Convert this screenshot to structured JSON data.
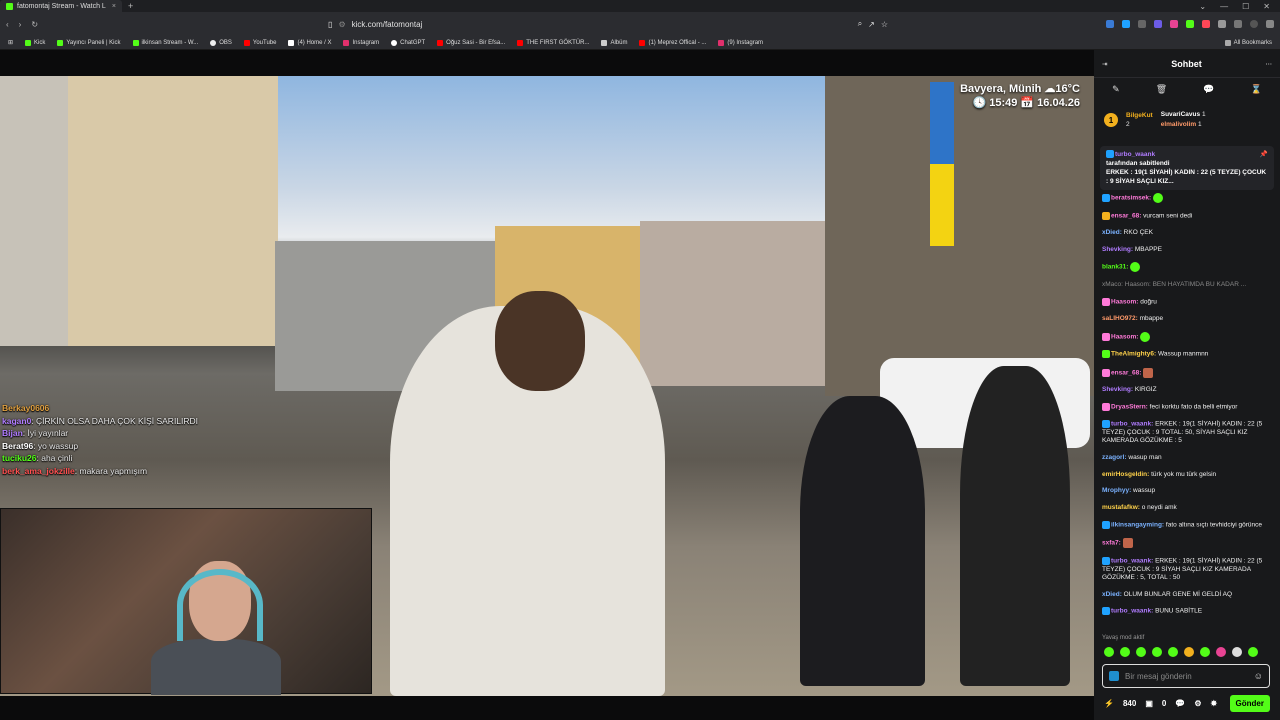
{
  "tab": {
    "title": "fatomontaj Stream - Watch L",
    "close": "×",
    "new": "+"
  },
  "window": {
    "min": "—",
    "max": "☐",
    "close": "✕"
  },
  "url": {
    "address": "kick.com/fatomontaj"
  },
  "bookmarks": [
    {
      "label": "Kick",
      "color": "#53fc18"
    },
    {
      "label": "Yayıncı Paneli | Kick",
      "color": "#53fc18"
    },
    {
      "label": "ilkinsan Stream - W...",
      "color": "#53fc18"
    },
    {
      "label": "OBS",
      "color": "#eeeeee"
    },
    {
      "label": "YouTube",
      "color": "#ff0000"
    },
    {
      "label": "(4) Home / X",
      "color": "#ffffff"
    },
    {
      "label": "Instagram",
      "color": "#e1306c"
    },
    {
      "label": "ChatGPT",
      "color": "#ffffff"
    },
    {
      "label": "Oğuz Sasi - Bir Efsa...",
      "color": "#ff0000"
    },
    {
      "label": "THE FIRST GÖKTÜR...",
      "color": "#ff0000"
    },
    {
      "label": "Albüm",
      "color": "#cccccc"
    },
    {
      "label": "(1) Meprez Offical - ...",
      "color": "#ff0000"
    },
    {
      "label": "(9) Instagram",
      "color": "#e1306c"
    }
  ],
  "all_bookmarks": "All Bookmarks",
  "overlay": {
    "location": "Bavyera, Münih ☁16°C",
    "time": "🕓 15:49  📅 16.04.26"
  },
  "video_chat": [
    {
      "user": "Berkay0606",
      "text": " ",
      "color": "#e0a040"
    },
    {
      "user": "kagan0",
      "text": ": ÇİRKİN OLSA DAHA ÇOK KİŞİ SARILIRDI",
      "color": "#b07cff"
    },
    {
      "user": "Bijan",
      "text": ": İyi yayınlar",
      "color": "#b07cff"
    },
    {
      "user": "Berat96",
      "text": ": yo wassup",
      "color": "#ffffff"
    },
    {
      "user": "tuciku26",
      "text": ": aha çinli",
      "color": "#53fc18"
    },
    {
      "user": "berk_ama_jokzille",
      "text": ": makara yapmışım",
      "color": "#ff5050"
    }
  ],
  "chat": {
    "title": "Sohbet",
    "leaderboard": [
      {
        "rank": "1",
        "name": "BilgeKut",
        "count": "2"
      },
      {
        "name": "SuvariCavus",
        "count": "1"
      },
      {
        "name": "elmalivolim",
        "count": "1"
      }
    ],
    "pinned_user": "turbo_waank",
    "pinned_by": "tarafından sabitlendi",
    "pinned_text": "ERKEK : 19(1 SİYAHİ) KADIN : 22 (5 TEYZE) ÇOCUK : 9 SİYAH SAÇLI KIZ...",
    "messages": [
      {
        "user": "beratsimsek:",
        "text": "",
        "color": "#ff7ad9"
      },
      {
        "user": "ensar_68:",
        "text": " vurcam seni dedi",
        "color": "#ff7ad9"
      },
      {
        "user": "xDied:",
        "text": " RKO ÇEK",
        "color": "#7bb2ff"
      },
      {
        "user": "Shevking:",
        "text": " MBAPPE",
        "color": "#b07cff"
      },
      {
        "user": "blank31:",
        "text": "",
        "color": "#53fc18"
      },
      {
        "user": "xMaco: Haasom:",
        "text": " BEN HAYATIMDA BU KADAR ...",
        "color": "#888888"
      },
      {
        "user": "Haasom:",
        "text": " doğru",
        "color": "#ff7ad9"
      },
      {
        "user": "saLIHO972:",
        "text": " mbappe",
        "color": "#ff9a6a"
      },
      {
        "user": "Haasom:",
        "text": "",
        "color": "#ff7ad9"
      },
      {
        "user": "TheAlmighty6:",
        "text": " Wassup manmnn",
        "color": "#ffd24a"
      },
      {
        "user": "ensar_68:",
        "text": "",
        "color": "#ff7ad9"
      },
      {
        "user": "Shevking:",
        "text": " KIRGIZ",
        "color": "#b07cff"
      },
      {
        "user": "DryasStern:",
        "text": " feci korktu fato da belli etmiyor",
        "color": "#ff7ad9"
      },
      {
        "user": "turbo_waank:",
        "text": " ERKEK : 19(1 SİYAHİ) KADIN : 22 (5 TEYZE) ÇOCUK : 9 TOTAL: 50, SİYAH SAÇLI KIZ KAMERADA GÖZÜKME : 5",
        "color": "#b07cff"
      },
      {
        "user": "zzagorl:",
        "text": " wasup man",
        "color": "#7bb2ff"
      },
      {
        "user": "emirHosgeldin:",
        "text": " türk yok mu türk gelsin",
        "color": "#ffd24a"
      },
      {
        "user": "Mrophyy:",
        "text": " wassup",
        "color": "#7bb2ff"
      },
      {
        "user": "mustafafkw:",
        "text": " o neydi amk",
        "color": "#ffd24a"
      },
      {
        "user": "ilkinsangayming:",
        "text": " fato altına sıçtı tevhidciyi görünce",
        "color": "#7bb2ff"
      },
      {
        "user": "sxfa7:",
        "text": "",
        "color": "#ff7ad9"
      },
      {
        "user": "turbo_waank:",
        "text": " ERKEK : 19(1 SİYAHİ) KADIN : 22 (5 TEYZE) ÇOCUK : 9 SİYAH SAÇLI KIZ KAMERADA GÖZÜKME : 5, TOTAL : 50",
        "color": "#b07cff"
      },
      {
        "user": "xDied:",
        "text": " OLUM BUNLAR GENE Mİ GELDİ AQ",
        "color": "#7bb2ff"
      },
      {
        "user": "turbo_waank:",
        "text": " BUNU SABİTLE",
        "color": "#b07cff"
      }
    ],
    "slow_mode": "Yavaş mod aktif",
    "input_placeholder": "Bir mesaj gönderin",
    "points": "840",
    "coins": "0",
    "send": "Gönder"
  }
}
